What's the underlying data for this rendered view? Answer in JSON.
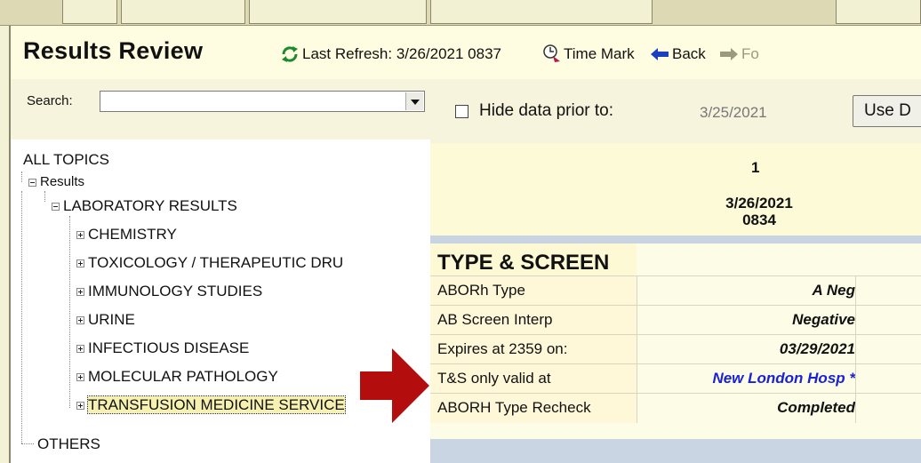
{
  "header": {
    "title": "Results Review",
    "refresh_label": "Last Refresh: 3/26/2021 0837",
    "time_mark_label": "Time Mark",
    "back_label": "Back",
    "forward_label": "Fo"
  },
  "search": {
    "label": "Search:",
    "value": ""
  },
  "tree": {
    "all_topics": "ALL TOPICS",
    "results": "Results",
    "lab_results": "LABORATORY RESULTS",
    "items": [
      "CHEMISTRY",
      "TOXICOLOGY / THERAPEUTIC DRU",
      "IMMUNOLOGY STUDIES",
      "URINE",
      "INFECTIOUS DISEASE",
      "MOLECULAR PATHOLOGY",
      "TRANSFUSION MEDICINE SERVICE"
    ],
    "others": "OTHERS"
  },
  "filter": {
    "hide_label": "Hide data prior to:",
    "hide_date": "3/25/2021",
    "use_button": "Use D",
    "hide_checked": false
  },
  "column": {
    "number": "1",
    "date": "3/26/2021",
    "time": "0834"
  },
  "section": {
    "title": "TYPE & SCREEN",
    "rows": [
      {
        "label": "ABORh Type",
        "value": "A Neg"
      },
      {
        "label": "AB Screen Interp",
        "value": "Negative"
      },
      {
        "label": "Expires at 2359 on:",
        "value": "03/29/2021"
      },
      {
        "label": "T&S only valid at",
        "value": "New London Hosp *"
      },
      {
        "label": "ABORH Type Recheck",
        "value": "Completed"
      }
    ]
  },
  "colors": {
    "background": "#f4f2d6",
    "link_blue": "#1a22d6",
    "arrow_red": "#b30d0d",
    "refresh_green": "#1a8a2a"
  }
}
